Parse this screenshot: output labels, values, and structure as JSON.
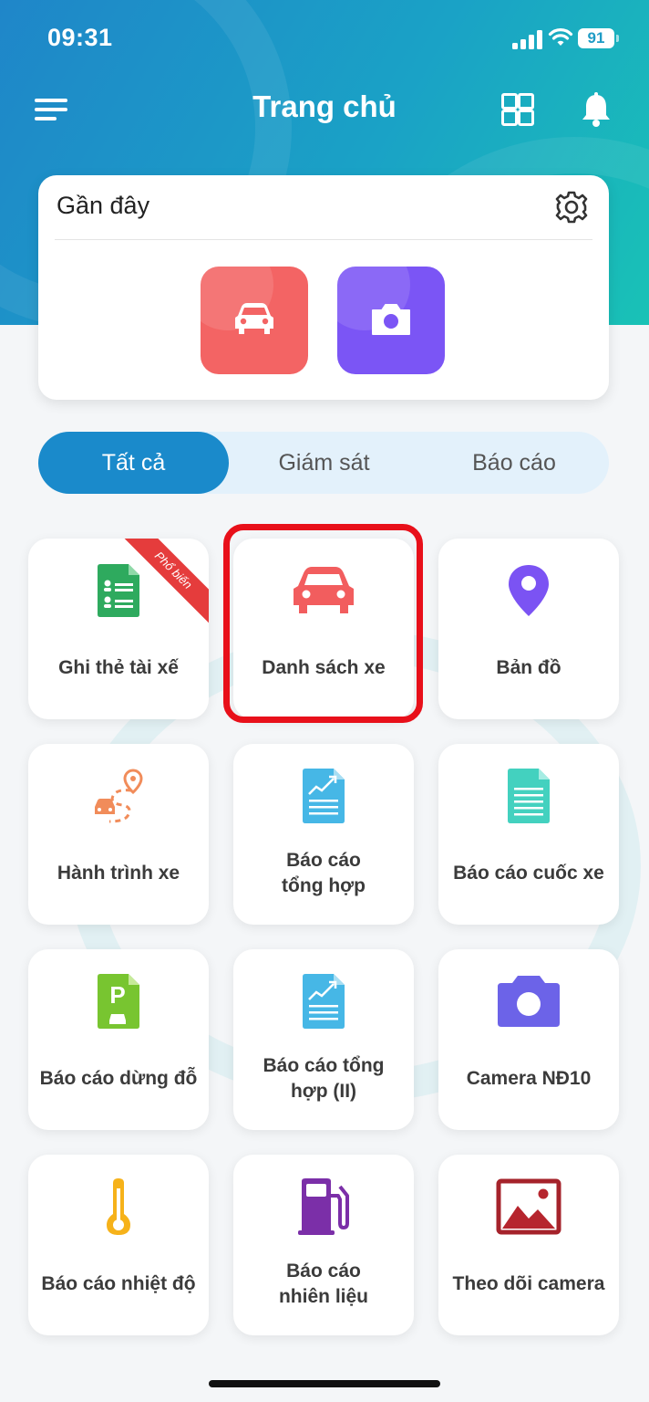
{
  "status_bar": {
    "time": "09:31",
    "battery": "91"
  },
  "header": {
    "title": "Trang chủ"
  },
  "recent": {
    "title": "Gần đây",
    "apps": [
      "car-app",
      "camera-app"
    ]
  },
  "tabs": [
    {
      "label": "Tất cả",
      "active": true
    },
    {
      "label": "Giám sát",
      "active": false
    },
    {
      "label": "Báo cáo",
      "active": false
    }
  ],
  "tiles": {
    "ghi_the": {
      "label": "Ghi thẻ tài xế",
      "badge": "Phổ biến",
      "icon": "driver-card-icon"
    },
    "danh_sach_xe": {
      "label": "Danh sách xe",
      "icon": "car-icon"
    },
    "ban_do": {
      "label": "Bản đồ",
      "icon": "map-pin-icon"
    },
    "hanh_trinh": {
      "label": "Hành trình xe",
      "icon": "route-icon"
    },
    "tong_hop": {
      "label": "Báo cáo tổng hợp",
      "icon": "report-chart-icon"
    },
    "cuoc_xe": {
      "label": "Báo cáo cuốc xe",
      "icon": "document-icon"
    },
    "dung_do": {
      "label": "Báo cáo dừng đỗ",
      "icon": "parking-icon"
    },
    "tong_hop_2": {
      "label": "Báo cáo tổng hợp (II)",
      "icon": "report-chart-icon"
    },
    "camera_nd10": {
      "label": "Camera NĐ10",
      "icon": "camera-icon"
    },
    "nhiet_do": {
      "label": "Báo cáo nhiệt độ",
      "icon": "thermometer-icon"
    },
    "nhien_lieu": {
      "label": "Báo cáo nhiên liệu",
      "icon": "fuel-pump-icon"
    },
    "theo_doi_camera": {
      "label": "Theo dõi camera",
      "icon": "image-icon"
    }
  },
  "colors": {
    "primary": "#1a8acb",
    "highlight_border": "#e8101a",
    "car_app": "#f25f60",
    "camera_app": "#7b54f5"
  }
}
